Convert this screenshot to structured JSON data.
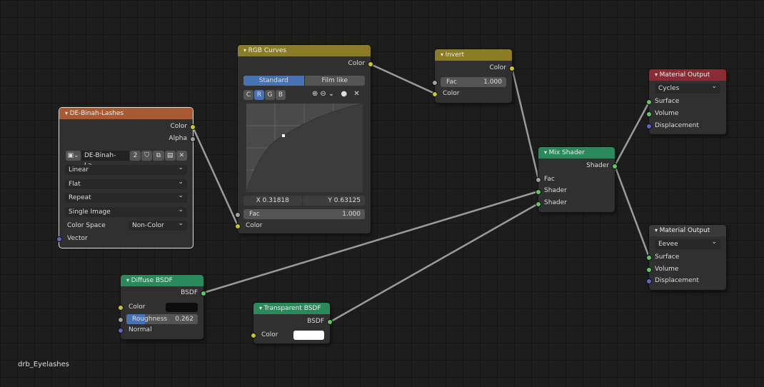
{
  "image_node": {
    "title": "DE-Binah-Lashes",
    "out_color": "Color",
    "out_alpha": "Alpha",
    "image_name": "DE-Binah-La...",
    "users": "2",
    "interpolation": "Linear",
    "projection": "Flat",
    "extension": "Repeat",
    "source": "Single Image",
    "color_space_label": "Color Space",
    "color_space": "Non-Color",
    "in_vector": "Vector",
    "color": "#a85a33"
  },
  "curves_node": {
    "title": "RGB Curves",
    "out_color": "Color",
    "tab_standard": "Standard",
    "tab_film": "Film like",
    "channels": [
      "C",
      "R",
      "G",
      "B"
    ],
    "x_value": "X 0.31818",
    "y_value": "Y 0.63125",
    "fac_label": "Fac",
    "fac_value": "1.000",
    "in_color": "Color",
    "color": "#8b7d26"
  },
  "invert_node": {
    "title": "Invert",
    "out_color": "Color",
    "fac_label": "Fac",
    "fac_value": "1.000",
    "in_color": "Color"
  },
  "mix_node": {
    "title": "Mix Shader",
    "out_shader": "Shader",
    "in_fac": "Fac",
    "in_shader1": "Shader",
    "in_shader2": "Shader",
    "color": "#2b8a5c"
  },
  "output1": {
    "title": "Material Output",
    "target": "Cycles",
    "surface": "Surface",
    "volume": "Volume",
    "displacement": "Displacement",
    "color": "#8b2b33"
  },
  "output2": {
    "title": "Material Output",
    "target": "Eevee",
    "surface": "Surface",
    "volume": "Volume",
    "displacement": "Displacement"
  },
  "diffuse_node": {
    "title": "Diffuse BSDF",
    "out": "BSDF",
    "in_color": "Color",
    "roughness_label": "Roughness",
    "roughness_value": "0.262",
    "in_normal": "Normal",
    "roughness": 0.262
  },
  "transparent_node": {
    "title": "Transparent BSDF",
    "out": "BSDF",
    "in_color": "Color"
  },
  "material_name": "drb_Eyelashes"
}
